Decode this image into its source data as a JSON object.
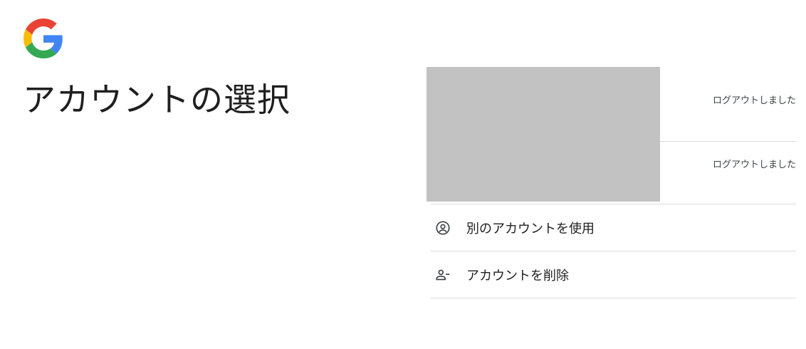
{
  "header": {
    "logo": "google-g-logo",
    "title": "アカウントの選択"
  },
  "accounts": [
    {
      "status": "ログアウトしました"
    },
    {
      "status": "ログアウトしました"
    }
  ],
  "redaction_color": "#c2c2c2",
  "actions": [
    {
      "label": "別のアカウントを使用",
      "icon": "account-circle-icon"
    },
    {
      "label": "アカウントを削除",
      "icon": "person-remove-icon"
    }
  ],
  "colors": {
    "google_blue": "#4285F4",
    "google_red": "#EA4335",
    "google_yellow": "#FBBC05",
    "google_green": "#34A853",
    "divider": "#dadce0"
  }
}
